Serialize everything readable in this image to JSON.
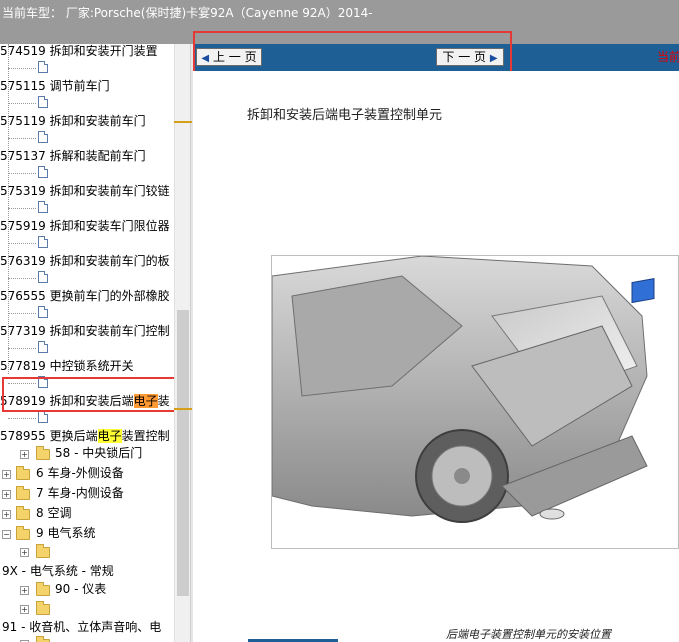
{
  "header": {
    "title": "当前车型： 厂家:Porsche(保时捷)卡宴92A（Cayenne 92A）2014-"
  },
  "tree": {
    "items": [
      {
        "code": "574519",
        "label": "拆卸和安装开门装置"
      },
      {
        "code": "575115",
        "label": "调节前车门"
      },
      {
        "code": "575119",
        "label": "拆卸和安装前车门"
      },
      {
        "code": "575137",
        "label": "拆解和装配前车门"
      },
      {
        "code": "575319",
        "label": "拆卸和安装前车门铰链"
      },
      {
        "code": "575919",
        "label": "拆卸和安装车门限位器"
      },
      {
        "code": "576319",
        "label": "拆卸和安装前车门的板"
      },
      {
        "code": "576555",
        "label": "更换前车门的外部橡胶"
      },
      {
        "code": "577319",
        "label": "拆卸和安装前车门控制"
      },
      {
        "code": "577819",
        "label": "中控锁系统开关"
      },
      {
        "code": "578919",
        "label_pre": "拆卸和安装后端",
        "label_hl": "电子",
        "label_post": "装"
      },
      {
        "code": "578955",
        "label_pre": "更换后端",
        "label_hl": "电子",
        "label_post": "装置控制"
      }
    ],
    "folders": [
      {
        "label": "58 - 中央锁后门"
      },
      {
        "label": "6 车身-外侧设备"
      },
      {
        "label": "7 车身-内侧设备"
      },
      {
        "label": "8 空调"
      },
      {
        "label": "9 电气系统"
      },
      {
        "label": ""
      },
      {
        "label": "9X - 电气系统 - 常规"
      },
      {
        "label": "90 - 仪表"
      },
      {
        "label": ""
      },
      {
        "label": "91 - 收音机、立体声音响、电"
      },
      {
        "label": ""
      }
    ]
  },
  "nav": {
    "prev_label": "上 一 页",
    "next_label": "下 一 页",
    "current_label": "当前"
  },
  "document": {
    "title": "拆卸和安装后端电子装置控制单元",
    "caption": "后端电子装置控制单元的安装位置"
  },
  "colors": {
    "nav_bar": "#1e6096",
    "highlight_red": "#e53935",
    "search_highlight": "#ffff33",
    "selected_highlight": "#ff9933"
  }
}
